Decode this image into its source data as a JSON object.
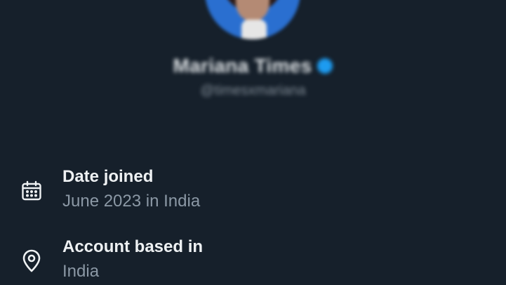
{
  "profile": {
    "display_name": "Mariana Times",
    "handle": "@timesxmariana",
    "verified": true
  },
  "about": {
    "date_joined": {
      "icon": "calendar-icon",
      "label": "Date joined",
      "value": "June 2023 in India"
    },
    "account_based_in": {
      "icon": "location-pin-icon",
      "label": "Account based in",
      "value": "India"
    }
  },
  "colors": {
    "background": "#16202b",
    "primary_text": "#eef1f3",
    "secondary_text": "#8b98a5",
    "verified_badge": "#1d9bf0"
  }
}
